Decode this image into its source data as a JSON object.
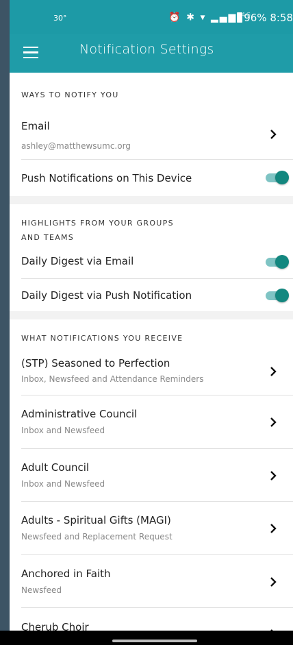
{
  "status_bar": {
    "temperature": "30°",
    "icons": "⏰ ✱ ▾ ▂▄▆",
    "signal_tag": "4G",
    "battery": "96%",
    "time": "8:58"
  },
  "app_bar": {
    "title": "Notification Settings",
    "menu_icon": "hamburger-menu-icon"
  },
  "section_ways": {
    "header": "WAYS TO NOTIFY YOU",
    "email_label": "Email",
    "email_value": "ashley@matthewsumc.org",
    "push_label": "Push Notifications on This Device",
    "push_enabled": true
  },
  "section_highlights": {
    "header_line1": "HIGHLIGHTS FROM YOUR GROUPS",
    "header_line2": "AND TEAMS",
    "digest_email_label": "Daily Digest via Email",
    "digest_email_enabled": true,
    "digest_push_label": "Daily Digest via Push Notification",
    "digest_push_enabled": true
  },
  "section_receive": {
    "header": "WHAT NOTIFICATIONS YOU RECEIVE",
    "items": [
      {
        "title": "(STP) Seasoned to Perfection",
        "subtitle": "Inbox, Newsfeed and Attendance Reminders"
      },
      {
        "title": "Administrative Council",
        "subtitle": "Inbox and Newsfeed"
      },
      {
        "title": "Adult Council",
        "subtitle": "Inbox and Newsfeed"
      },
      {
        "title": "Adults - Spiritual Gifts (MAGI)",
        "subtitle": "Newsfeed and Replacement Request"
      },
      {
        "title": "Anchored in Faith",
        "subtitle": "Newsfeed"
      },
      {
        "title": "Cherub Choir",
        "subtitle": ""
      }
    ]
  },
  "colors": {
    "accent": "#1f9ca8",
    "toggle_on": "#13877f",
    "toggle_track": "#7fc4c4"
  }
}
